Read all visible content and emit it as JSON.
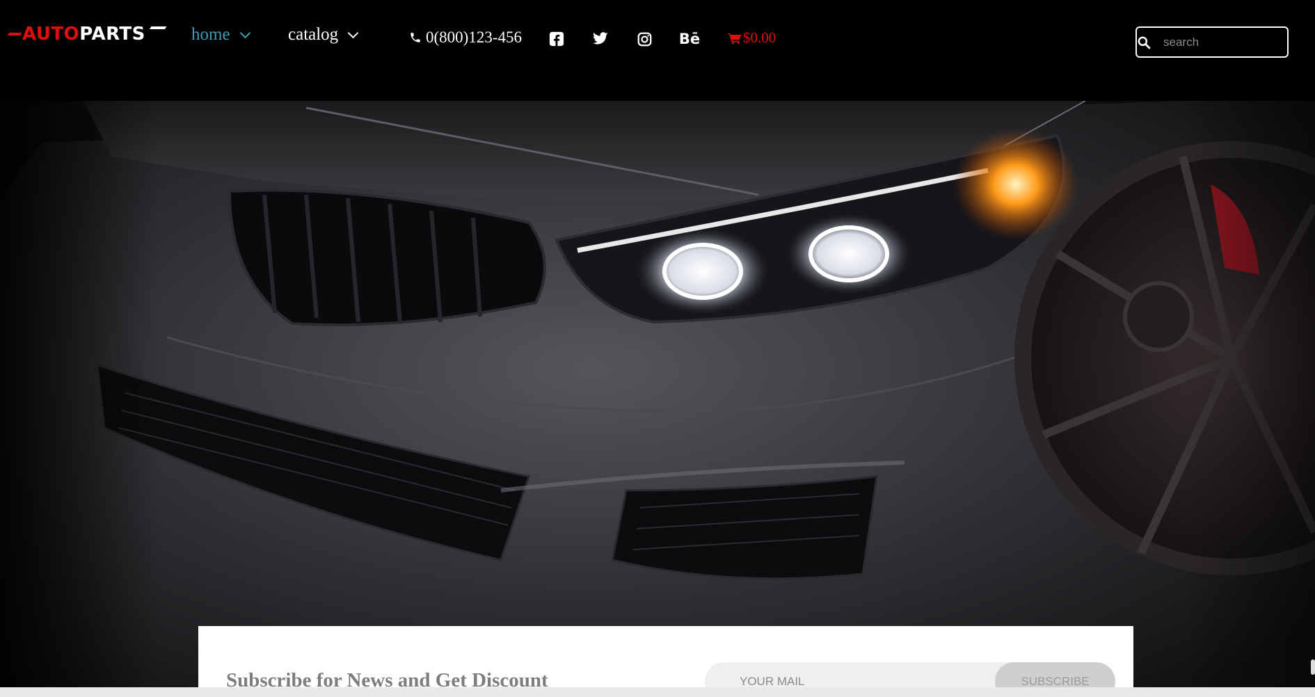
{
  "brand": {
    "logo_left": "AUTO",
    "logo_right": "PARTS",
    "logo_color": "#e10e0e"
  },
  "nav": {
    "items": [
      {
        "label": "home",
        "active": true
      },
      {
        "label": "catalog",
        "active": false
      }
    ],
    "active_color": "#3aa0b5"
  },
  "contact": {
    "phone": "0(800)123-456",
    "icon": "phone-icon"
  },
  "social": [
    {
      "name": "facebook",
      "icon": "facebook-icon"
    },
    {
      "name": "twitter",
      "icon": "twitter-icon"
    },
    {
      "name": "instagram",
      "icon": "instagram-icon"
    },
    {
      "name": "behance",
      "icon": "behance-icon",
      "glyph": "Bē"
    }
  ],
  "cart": {
    "total": "$0.00",
    "icon": "cart-icon",
    "color": "#e10e0e"
  },
  "search": {
    "placeholder": "search",
    "icon": "search-icon"
  },
  "hero": {
    "image": "black sports car front with headlight"
  },
  "subscribe": {
    "title": "Subscribe for News and Get Discount",
    "email_placeholder": "YOUR MAIL",
    "button_label": "SUBSCRIBE"
  }
}
